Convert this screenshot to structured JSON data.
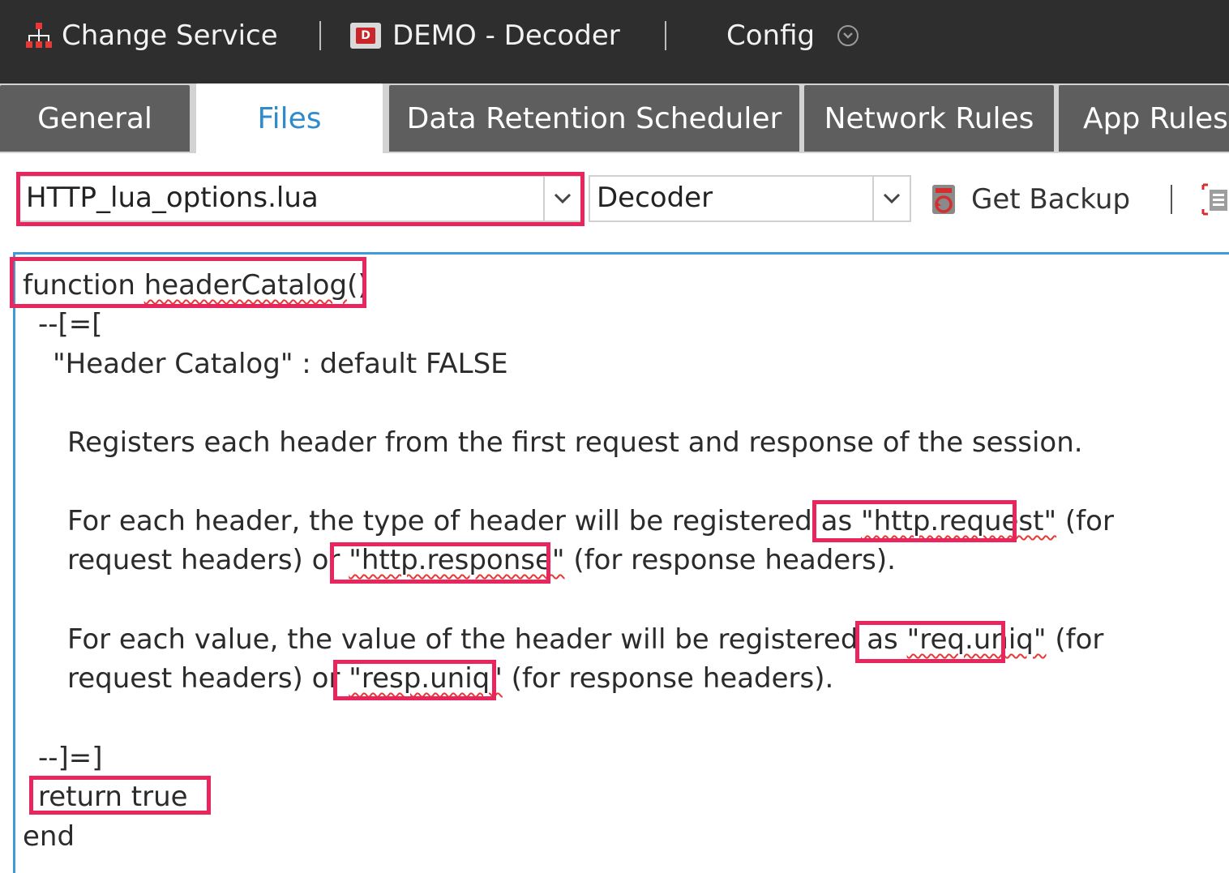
{
  "topbar": {
    "change_service": "Change Service",
    "device": "DEMO - Decoder",
    "view": "Config"
  },
  "tabs": [
    {
      "label": "General",
      "active": false
    },
    {
      "label": "Files",
      "active": true
    },
    {
      "label": "Data Retention Scheduler",
      "active": false
    },
    {
      "label": "Network Rules",
      "active": false
    },
    {
      "label": "App Rules",
      "active": false
    }
  ],
  "toolbar": {
    "file_select": "HTTP_lua_options.lua",
    "service_select": "Decoder",
    "get_backup": "Get Backup"
  },
  "code": {
    "l1_func": "function ",
    "l1_name": "headerCatalog",
    "l1_paren": "()",
    "l2": "--[=[",
    "l3": "\"Header Catalog\" : default FALSE",
    "l4": "Registers each header from the first request and response of the session.",
    "l5_a": "For each header, the type of header will be registered as ",
    "l5_b": "\"http.request\"",
    "l5_c": " (for",
    "l6_a": "request headers) or ",
    "l6_b": "\"http.response\"",
    "l6_c": " (for response headers).",
    "l7_a": "For each value, the value of the header will be registered as ",
    "l7_b": "\"req.uniq\"",
    "l7_c": " (for",
    "l8_a": "request headers) or ",
    "l8_b": "\"resp.uniq\"",
    "l8_c": " (for response headers).",
    "l9": "--]=]",
    "l10": "return true",
    "l11": "end"
  },
  "colors": {
    "topbar": "#2e2e2e",
    "tab_inactive": "#5e5e5e",
    "tab_active_text": "#2e8bcc",
    "highlight": "#e8255c",
    "editor_border": "#3f9ad6",
    "spellcheck": "#e53935"
  },
  "icons": {
    "service": "change-service-icon",
    "decoder": "decoder-device-icon",
    "config_menu": "chevron-down-circle-icon",
    "backup": "backup-icon",
    "more": "document-icon"
  }
}
